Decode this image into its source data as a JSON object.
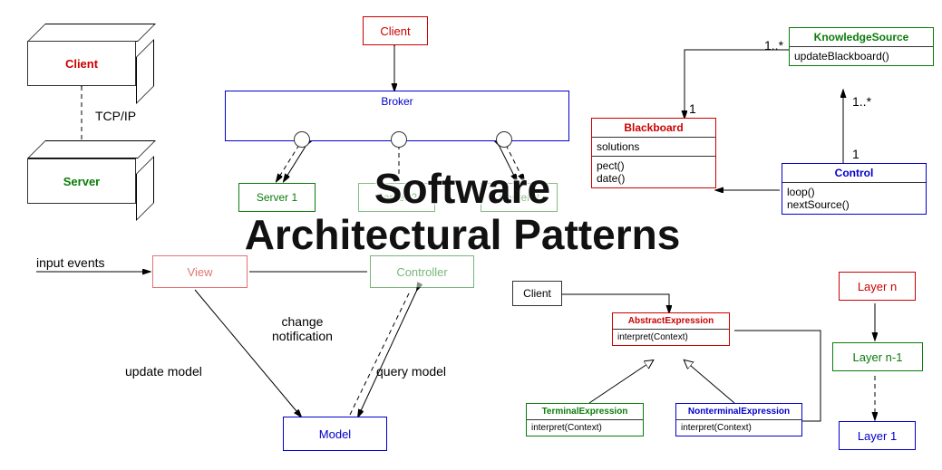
{
  "title_main": "Software\nArchitectural Patterns",
  "client_server": {
    "client": "Client",
    "server": "Server",
    "protocol": "TCP/IP"
  },
  "broker": {
    "client": "Client",
    "broker": "Broker",
    "servers": [
      "Server 1",
      "Server 2",
      "Server 3"
    ]
  },
  "mvc": {
    "view": "View",
    "controller": "Controller",
    "model": "Model",
    "input_events": "input events",
    "change_notification": "change\nnotification",
    "update_model": "update model",
    "query_model": "query model"
  },
  "blackboard": {
    "knowledge_source": {
      "name": "KnowledgeSource",
      "method": "updateBlackboard()"
    },
    "blackboard": {
      "name": "Blackboard",
      "attr": "solutions",
      "methods": "pect()\ndate()"
    },
    "control": {
      "name": "Control",
      "methods": "loop()\nnextSource()"
    },
    "mult_1": "1",
    "mult_many": "1..*"
  },
  "interpreter": {
    "client": "Client",
    "abstract": {
      "name": "AbstractExpression",
      "method": "interpret(Context)"
    },
    "terminal": {
      "name": "TerminalExpression",
      "method": "interpret(Context)"
    },
    "nonterminal": {
      "name": "NonterminalExpression",
      "method": "interpret(Context)"
    }
  },
  "layers": {
    "top": "Layer n",
    "mid": "Layer n-1",
    "bottom": "Layer 1"
  }
}
